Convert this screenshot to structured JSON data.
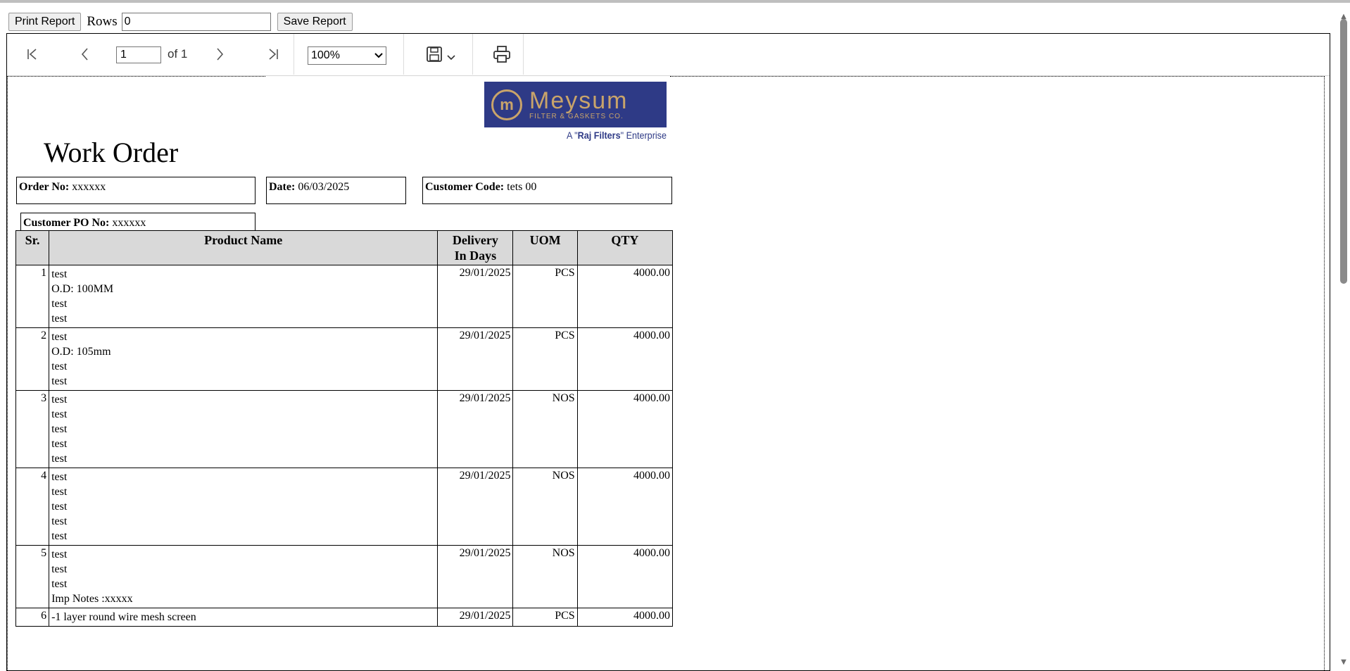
{
  "topbar": {
    "print_label": "Print Report",
    "rows_label": "Rows",
    "rows_value": "0",
    "save_label": "Save Report"
  },
  "toolbar": {
    "page_value": "1",
    "page_of": "of 1",
    "zoom_value": "100%",
    "icons": [
      "first-page-icon",
      "prev-page-icon",
      "next-page-icon",
      "last-page-icon",
      "save-icon",
      "chevron-down-icon",
      "print-icon"
    ]
  },
  "report": {
    "logo_mark": "m",
    "logo_name": "Meysum",
    "logo_sub": "FILTER & GASKETS CO.",
    "tagline_pre": "A \"",
    "tagline_bold": "Raj Filters",
    "tagline_post": "\" Enterprise",
    "title": "Work Order",
    "order_no_label": "Order No:",
    "order_no_value": "xxxxxx",
    "date_label": "Date:",
    "date_value": "06/03/2025",
    "customer_code_label": "Customer Code:",
    "customer_code_value": "tets 00",
    "customer_po_label": "Customer PO No:",
    "customer_po_value": "xxxxxx",
    "headers": {
      "sr": "Sr.",
      "product": "Product Name",
      "delivery_1": "Delivery",
      "delivery_2": "In Days",
      "uom": "UOM",
      "qty": "QTY"
    },
    "rows": [
      {
        "sr": "1",
        "lines": [
          "test",
          "O.D: 100MM",
          "test",
          "test"
        ],
        "delivery": "29/01/2025",
        "uom": "PCS",
        "qty": "4000.00"
      },
      {
        "sr": "2",
        "lines": [
          "test",
          "O.D: 105mm",
          "test",
          "test"
        ],
        "delivery": "29/01/2025",
        "uom": "PCS",
        "qty": "4000.00"
      },
      {
        "sr": "3",
        "lines": [
          "test",
          "test",
          "test",
          "test",
          "test"
        ],
        "delivery": "29/01/2025",
        "uom": "NOS",
        "qty": "4000.00"
      },
      {
        "sr": "4",
        "lines": [
          "test",
          "test",
          "test",
          "test",
          "test"
        ],
        "delivery": "29/01/2025",
        "uom": "NOS",
        "qty": "4000.00"
      },
      {
        "sr": "5",
        "lines": [
          "test",
          "test",
          "test",
          "Imp Notes :xxxxx"
        ],
        "delivery": "29/01/2025",
        "uom": "NOS",
        "qty": "4000.00"
      },
      {
        "sr": "6",
        "lines": [
          "-1 layer round wire mesh screen"
        ],
        "delivery": "29/01/2025",
        "uom": "PCS",
        "qty": "4000.00"
      }
    ]
  }
}
